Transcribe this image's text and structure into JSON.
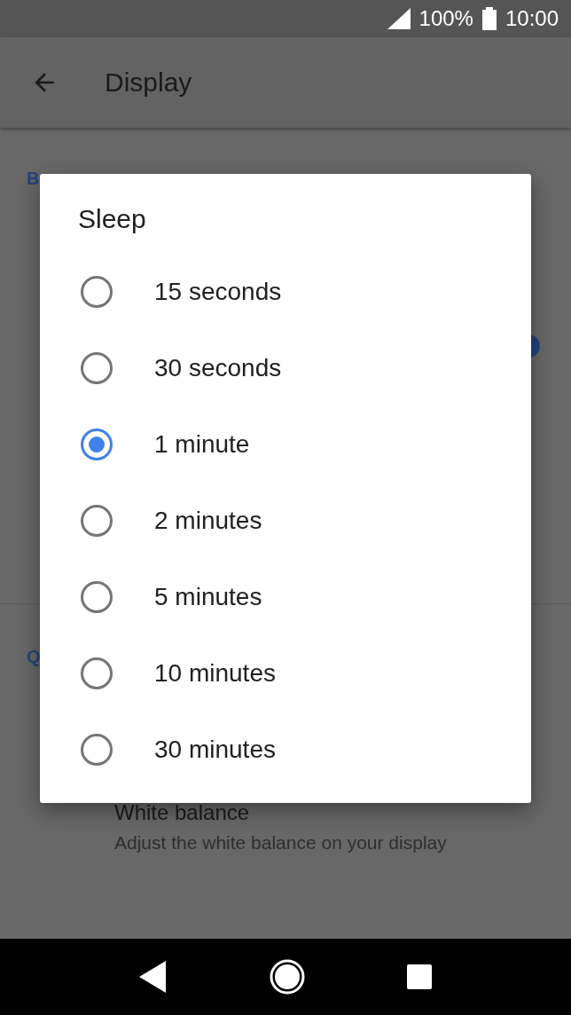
{
  "status_bar": {
    "battery": "100%",
    "time": "10:00"
  },
  "app_bar": {
    "title": "Display"
  },
  "sections": [
    {
      "header": "B",
      "toggle": {
        "on": true
      }
    },
    {
      "header": "Q",
      "items": [
        {
          "title": "White balance",
          "subtitle": "Adjust the white balance on your display"
        }
      ]
    }
  ],
  "dialog": {
    "title": "Sleep",
    "options": [
      {
        "label": "15 seconds",
        "selected": false
      },
      {
        "label": "30 seconds",
        "selected": false
      },
      {
        "label": "1 minute",
        "selected": true
      },
      {
        "label": "2 minutes",
        "selected": false
      },
      {
        "label": "5 minutes",
        "selected": false
      },
      {
        "label": "10 minutes",
        "selected": false
      },
      {
        "label": "30 minutes",
        "selected": false
      }
    ]
  }
}
